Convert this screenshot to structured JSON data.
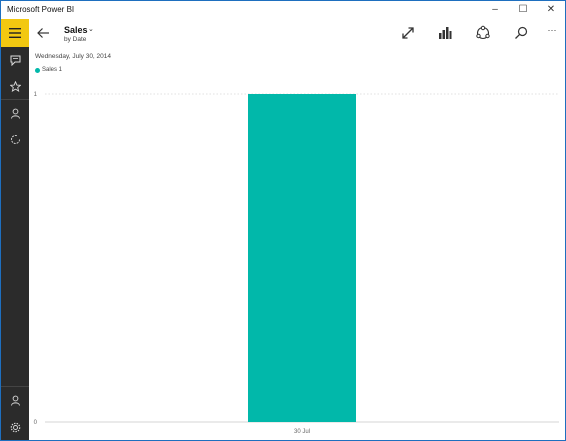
{
  "window": {
    "title": "Microsoft Power BI",
    "controls": {
      "minimize": "–",
      "maximize": "☐",
      "close": "✕"
    }
  },
  "sidebar": {
    "items": [
      {
        "icon": "hamburger-menu-icon"
      },
      {
        "icon": "reports-icon"
      },
      {
        "icon": "favorites-star-icon"
      },
      {
        "icon": "person-icon"
      },
      {
        "icon": "refresh-icon"
      }
    ],
    "bottom": [
      {
        "icon": "account-icon"
      },
      {
        "icon": "settings-gear-icon"
      }
    ]
  },
  "header": {
    "title": "Sales",
    "subtitle": "by Date",
    "actions": [
      "expand-icon",
      "chart-type-icon",
      "share-icon",
      "search-icon",
      "more-icon"
    ],
    "more_label": "···"
  },
  "date_label": "Wednesday, July 30, 2014",
  "colors": {
    "accent": "#f2c811",
    "bar": "#01b8aa",
    "sidebar": "#2b2b2b"
  },
  "chart_data": {
    "type": "bar",
    "categories": [
      "30 Jul"
    ],
    "series": [
      {
        "name": "Sales 1",
        "values": [
          1
        ]
      }
    ],
    "ylim": [
      0,
      1
    ],
    "y_ticks": [
      "0",
      "1"
    ],
    "grid": true,
    "legend": "top-left"
  }
}
